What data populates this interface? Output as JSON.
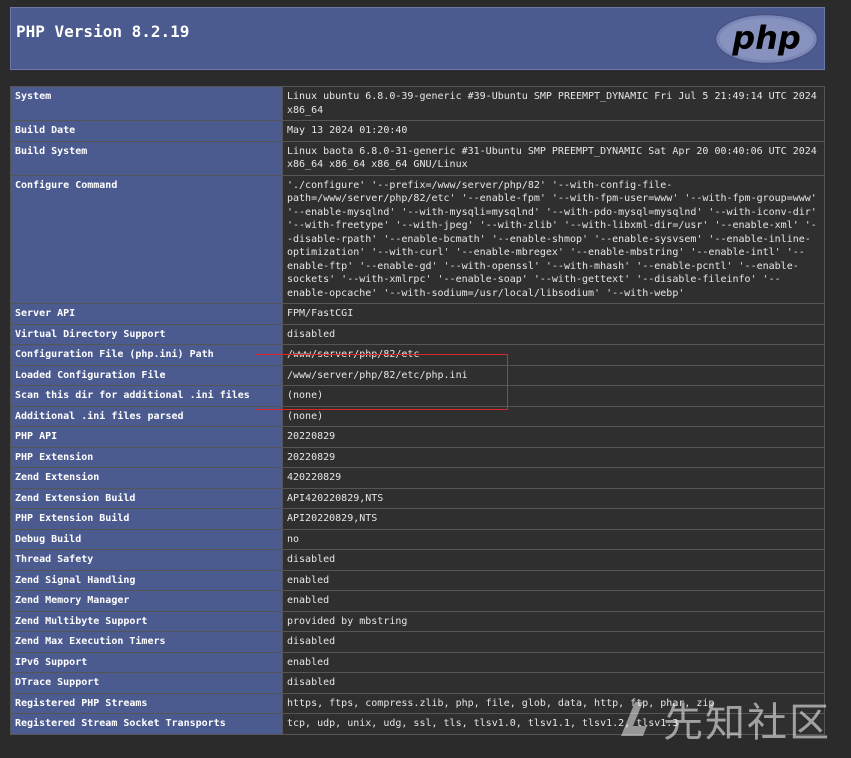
{
  "header": {
    "title": "PHP Version 8.2.19",
    "logo_text": "php"
  },
  "rows": [
    {
      "key": "System",
      "value": "Linux ubuntu 6.8.0-39-generic #39-Ubuntu SMP PREEMPT_DYNAMIC Fri Jul 5 21:49:14 UTC 2024 x86_64"
    },
    {
      "key": "Build Date",
      "value": "May 13 2024 01:20:40"
    },
    {
      "key": "Build System",
      "value": "Linux baota 6.8.0-31-generic #31-Ubuntu SMP PREEMPT_DYNAMIC Sat Apr 20 00:40:06 UTC 2024 x86_64 x86_64 x86_64 GNU/Linux"
    },
    {
      "key": "Configure Command",
      "value": "'./configure' '--prefix=/www/server/php/82' '--with-config-file-path=/www/server/php/82/etc' '--enable-fpm' '--with-fpm-user=www' '--with-fpm-group=www' '--enable-mysqlnd' '--with-mysqli=mysqlnd' '--with-pdo-mysql=mysqlnd' '--with-iconv-dir' '--with-freetype' '--with-jpeg' '--with-zlib' '--with-libxml-dir=/usr' '--enable-xml' '--disable-rpath' '--enable-bcmath' '--enable-shmop' '--enable-sysvsem' '--enable-inline-optimization' '--with-curl' '--enable-mbregex' '--enable-mbstring' '--enable-intl' '--enable-ftp' '--enable-gd' '--with-openssl' '--with-mhash' '--enable-pcntl' '--enable-sockets' '--with-xmlrpc' '--enable-soap' '--with-gettext' '--disable-fileinfo' '--enable-opcache' '--with-sodium=/usr/local/libsodium' '--with-webp'"
    },
    {
      "key": "Server API",
      "value": "FPM/FastCGI"
    },
    {
      "key": "Virtual Directory Support",
      "value": "disabled"
    },
    {
      "key": "Configuration File (php.ini) Path",
      "value": "/www/server/php/82/etc"
    },
    {
      "key": "Loaded Configuration File",
      "value": "/www/server/php/82/etc/php.ini"
    },
    {
      "key": "Scan this dir for additional .ini files",
      "value": "(none)"
    },
    {
      "key": "Additional .ini files parsed",
      "value": "(none)"
    },
    {
      "key": "PHP API",
      "value": "20220829"
    },
    {
      "key": "PHP Extension",
      "value": "20220829"
    },
    {
      "key": "Zend Extension",
      "value": "420220829"
    },
    {
      "key": "Zend Extension Build",
      "value": "API420220829,NTS"
    },
    {
      "key": "PHP Extension Build",
      "value": "API20220829,NTS"
    },
    {
      "key": "Debug Build",
      "value": "no"
    },
    {
      "key": "Thread Safety",
      "value": "disabled"
    },
    {
      "key": "Zend Signal Handling",
      "value": "enabled"
    },
    {
      "key": "Zend Memory Manager",
      "value": "enabled"
    },
    {
      "key": "Zend Multibyte Support",
      "value": "provided by mbstring"
    },
    {
      "key": "Zend Max Execution Timers",
      "value": "disabled"
    },
    {
      "key": "IPv6 Support",
      "value": "enabled"
    },
    {
      "key": "DTrace Support",
      "value": "disabled"
    },
    {
      "key": "Registered PHP Streams",
      "value": "https, ftps, compress.zlib, php, file, glob, data, http, ftp, phar, zip"
    },
    {
      "key": "Registered Stream Socket Transports",
      "value": "tcp, udp, unix, udg, ssl, tls, tlsv1.0, tlsv1.1, tlsv1.2, tlsv1.3"
    }
  ],
  "watermark": {
    "text": "先知社区"
  },
  "colors": {
    "header_bg": "#4b5a8f",
    "value_bg": "#2f2f2f",
    "highlight": "#e0242b",
    "logo_bg": "#7a86b8"
  }
}
